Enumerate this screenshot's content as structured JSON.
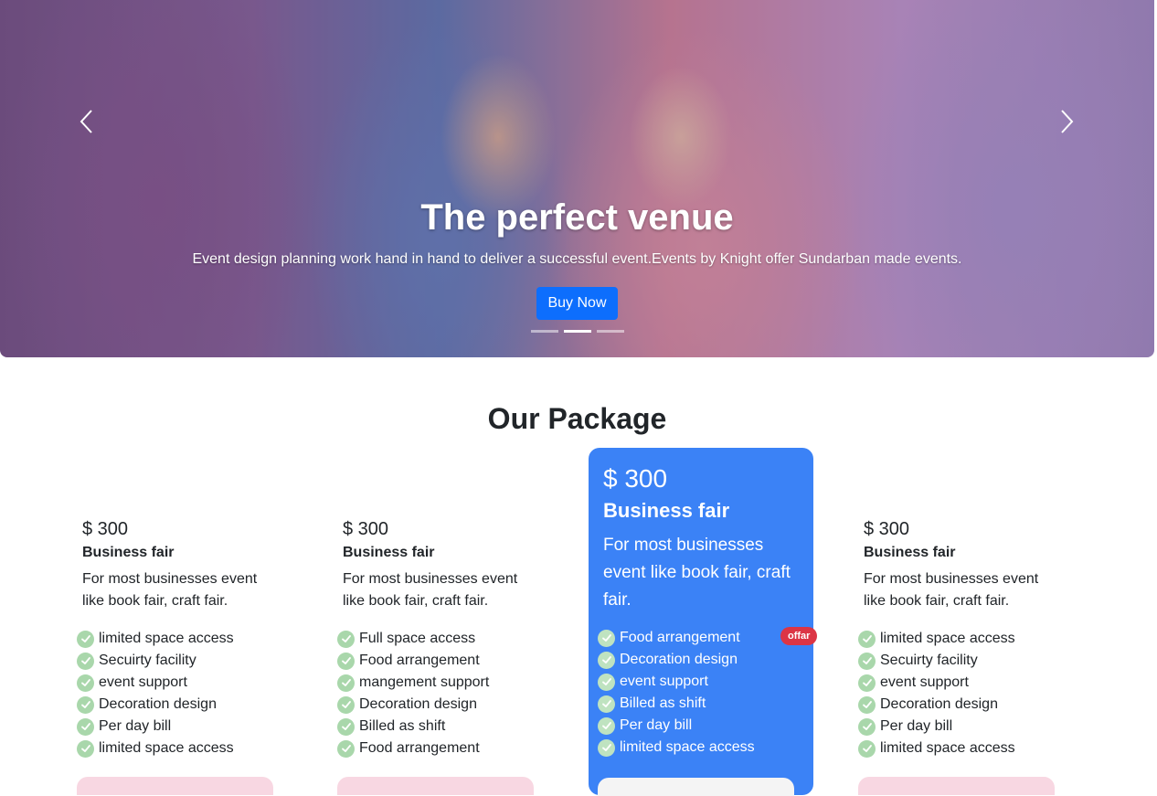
{
  "hero": {
    "title": "The perfect venue",
    "subtitle": "Event design planning work hand in hand to deliver a successful event.Events by Knight offer Sundarban made events.",
    "button_label": "Buy Now",
    "active_slide": 2,
    "slide_count": 3
  },
  "section": {
    "title": "Our Package"
  },
  "packages": [
    {
      "price": "$ 300",
      "name": "Business fair",
      "description": "For most businesses event like book fair, craft fair.",
      "features": [
        "limited space access",
        "Secuirty facility",
        "event support",
        "Decoration design",
        "Per day bill",
        "limited space access"
      ]
    },
    {
      "price": "$ 300",
      "name": "Business fair",
      "description": "For most businesses event like book fair, craft fair.",
      "features": [
        "Full space access",
        "Food arrangement",
        "mangement support",
        "Decoration design",
        "Billed as shift",
        "Food arrangement"
      ]
    },
    {
      "price": "$ 300",
      "name": "Business fair",
      "description": "For most businesses event like book fair, craft fair.",
      "badge": "offar",
      "features": [
        "Food arrangement",
        "Decoration design",
        "event support",
        "Billed as shift",
        "Per day bill",
        "limited space access"
      ]
    },
    {
      "price": "$ 300",
      "name": "Business fair",
      "description": "For most businesses event like book fair, craft fair.",
      "features": [
        "limited space access",
        "Secuirty facility",
        "event support",
        "Decoration design",
        "Per day bill",
        "limited space access"
      ]
    }
  ],
  "colors": {
    "primary_button": "#0d6efd",
    "featured_card": "#3b82f6",
    "badge": "#dc3545",
    "check": "#a9d7ab"
  }
}
